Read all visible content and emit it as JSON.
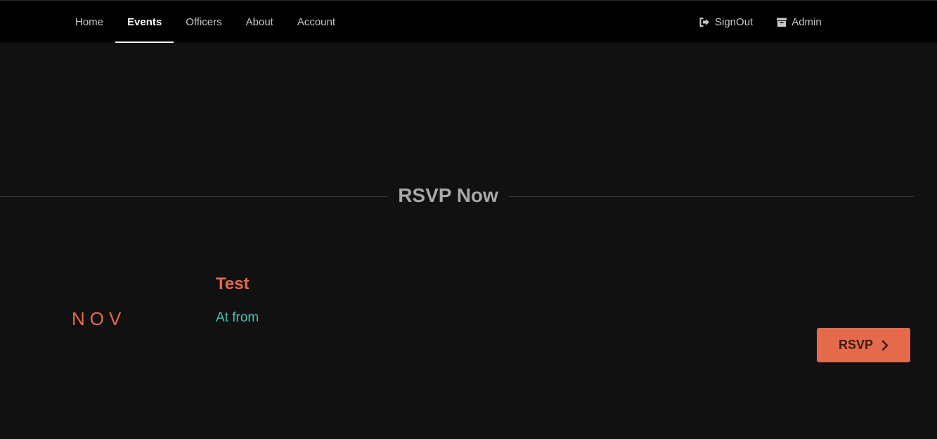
{
  "nav": {
    "left": [
      {
        "label": "Home",
        "active": false
      },
      {
        "label": "Events",
        "active": true
      },
      {
        "label": "Officers",
        "active": false
      },
      {
        "label": "About",
        "active": false
      },
      {
        "label": "Account",
        "active": false
      }
    ],
    "right": [
      {
        "label": "SignOut",
        "icon": "sign-out-icon"
      },
      {
        "label": "Admin",
        "icon": "archive-icon"
      }
    ]
  },
  "section": {
    "title": "RSVP Now"
  },
  "event": {
    "month": "NOV",
    "title": "Test",
    "subtitle": "At from",
    "button_label": "RSVP",
    "button_icon": "chevron-right-icon"
  },
  "colors": {
    "accent": "#e46a4b",
    "teal": "#45c3bb",
    "background": "#111111",
    "topbar": "#000000"
  }
}
